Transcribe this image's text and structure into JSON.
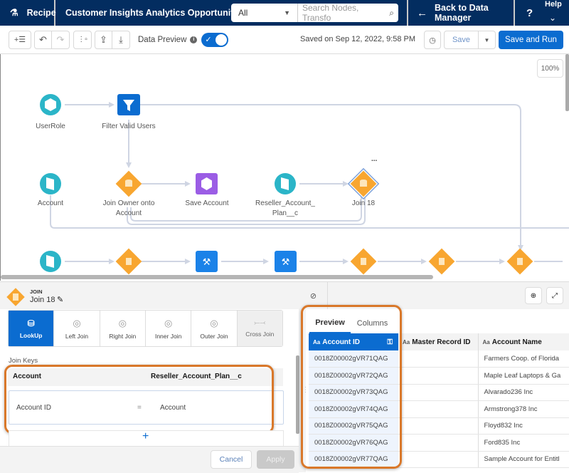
{
  "topbar": {
    "app_label": "Recipe",
    "recipe_title": "Customer Insights Analytics Opportunity ...",
    "search_scope": "All",
    "search_placeholder": "Search Nodes, Transfo",
    "back_label": "Back to Data Manager",
    "help_label": "Help",
    "help_glyph": "?"
  },
  "toolbar": {
    "data_preview_label": "Data Preview",
    "data_preview_on": true,
    "saved_text": "Saved on Sep 12, 2022, 9:58 PM",
    "save_label": "Save",
    "save_run_label": "Save and Run"
  },
  "canvas": {
    "zoom_level": "100%",
    "more_glyph": "...",
    "nodes": [
      {
        "id": "userrole",
        "label": "UserRole",
        "type": "input-object"
      },
      {
        "id": "filter",
        "label": "Filter Valid Users",
        "type": "filter"
      },
      {
        "id": "account",
        "label": "Account",
        "type": "input"
      },
      {
        "id": "join-owner",
        "label": "Join Owner onto Account",
        "type": "join"
      },
      {
        "id": "save-account",
        "label": "Save Account",
        "type": "output"
      },
      {
        "id": "reseller",
        "label": "Reseller_Account_ Plan__c",
        "type": "input"
      },
      {
        "id": "join18",
        "label": "Join 18",
        "type": "join",
        "selected": true
      },
      {
        "id": "r3-input",
        "label": "",
        "type": "input"
      },
      {
        "id": "r3-join1",
        "label": "",
        "type": "join"
      },
      {
        "id": "r3-transform1",
        "label": "",
        "type": "transform"
      },
      {
        "id": "r3-transform2",
        "label": "",
        "type": "transform"
      },
      {
        "id": "r3-join2",
        "label": "",
        "type": "join"
      },
      {
        "id": "r3-join3",
        "label": "",
        "type": "join"
      },
      {
        "id": "r3-join4",
        "label": "",
        "type": "join"
      }
    ]
  },
  "node_panel": {
    "type_label": "JOIN",
    "name": "Join 18",
    "join_types": [
      {
        "label": "LookUp",
        "active": true
      },
      {
        "label": "Left Join",
        "active": false
      },
      {
        "label": "Right Join",
        "active": false
      },
      {
        "label": "Inner Join",
        "active": false
      },
      {
        "label": "Outer Join",
        "active": false
      },
      {
        "label": "Cross Join",
        "active": false,
        "disabled": true
      }
    ],
    "join_keys_label": "Join Keys",
    "left_source": "Account",
    "right_source": "Reseller_Account_Plan__c",
    "key_left": "Account ID",
    "key_operator": "=",
    "key_right": "Account",
    "add_glyph": "+",
    "cancel_label": "Cancel",
    "apply_label": "Apply"
  },
  "preview": {
    "tabs": [
      "Preview",
      "Columns"
    ],
    "active_tab": "Preview",
    "type_glyph": "Aa",
    "columns": [
      "Account ID",
      "Master Record ID",
      "Account Name"
    ],
    "rows": [
      [
        "0018Z00002gVR71QAG",
        "",
        "Farmers Coop. of Florida"
      ],
      [
        "0018Z00002gVR72QAG",
        "",
        "Maple Leaf Laptops & Ga"
      ],
      [
        "0018Z00002gVR73QAG",
        "",
        "Alvarado236 Inc"
      ],
      [
        "0018Z00002gVR74QAG",
        "",
        "Armstrong378 Inc"
      ],
      [
        "0018Z00002gVR75QAG",
        "",
        "Floyd832 Inc"
      ],
      [
        "0018Z00002gVR76QAG",
        "",
        "Ford835 Inc"
      ],
      [
        "0018Z00002gVR77QAG",
        "",
        "Sample Account for Entitl"
      ]
    ]
  },
  "colors": {
    "nav_bg": "#032d60",
    "brand_blue": "#0b6cd0",
    "input_teal": "#2bb5c8",
    "join_orange": "#f8a630",
    "output_purple": "#9b5de5",
    "highlight_orange": "#d9782a"
  }
}
